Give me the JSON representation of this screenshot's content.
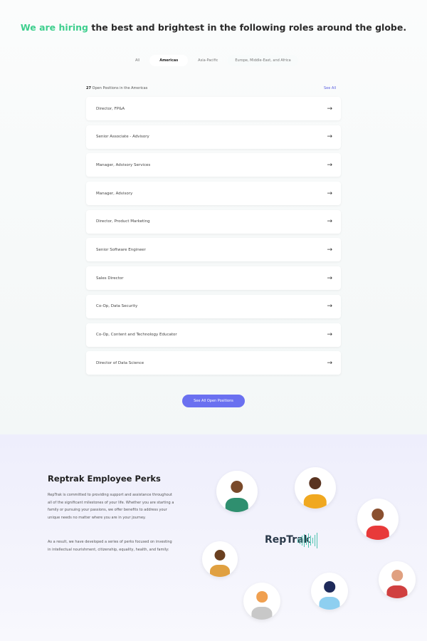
{
  "hero": {
    "title_highlight": "We are hiring",
    "title_rest": " the best and brightest in the following roles around the globe."
  },
  "tabs": [
    "All",
    "Americas",
    "Asia-Pacific",
    "Europe, Middle-East, and Africa"
  ],
  "positions": {
    "count": "27",
    "count_label": " Open Positions in the Americas",
    "see_all": "See All",
    "items": [
      "Director, FP&A",
      "Senior Associate - Advisory",
      "Manager, Advisory Services",
      "Manager, Advisory",
      "Director, Product Marketing",
      "Senior Software Engineer",
      "Sales Director",
      "Co-Op, Data Security",
      "Co-Op, Content and Technology Educator",
      "Director of Data Science"
    ]
  },
  "cta": "See All Open Positions",
  "perks": {
    "title": "Reptrak Employee Perks",
    "p1": "RepTrak is committed to providing support and assistance throughout all of the significant milestones of your life. Whether you are starting a family or pursuing your passions, we offer benefits to address your unique needs no matter where you are in your journey.",
    "p2": "As a result, we have developed a series of perks focused on investing in intellectual nourishment, citizenship, equality, health, and family:",
    "logo": "RepTrak"
  },
  "colors": {
    "accent": "#3ecf8e",
    "button": "#6a70f0"
  }
}
